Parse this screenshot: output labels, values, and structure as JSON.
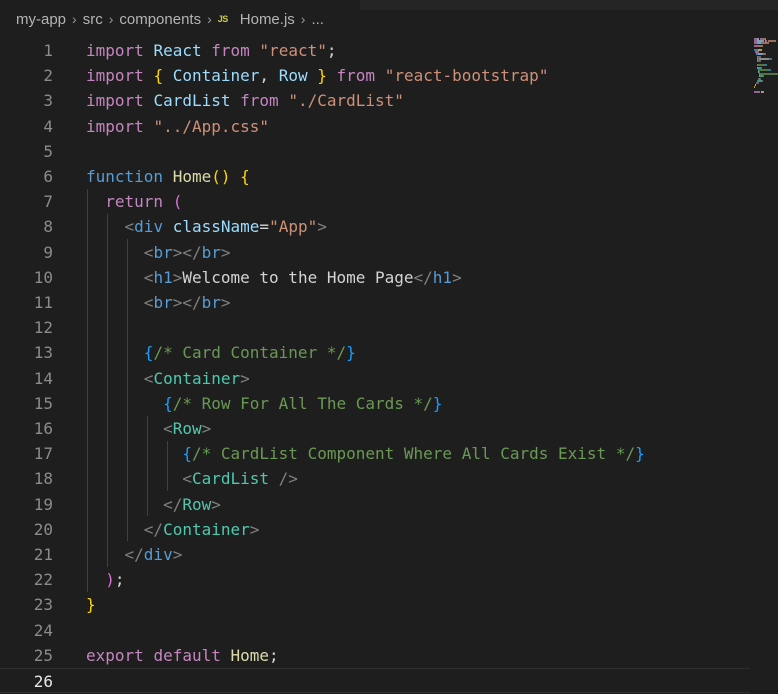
{
  "breadcrumb": {
    "items": [
      "my-app",
      "src",
      "components"
    ],
    "file_icon": "JS",
    "file_name": "Home.js",
    "trailing": "..."
  },
  "editor": {
    "current_line": 26,
    "lines": [
      {
        "n": "1",
        "tokens": [
          [
            "kw",
            "import"
          ],
          [
            "txt",
            " "
          ],
          [
            "var",
            "React"
          ],
          [
            "txt",
            " "
          ],
          [
            "kw",
            "from"
          ],
          [
            "txt",
            " "
          ],
          [
            "str",
            "\"react\""
          ],
          [
            "txt",
            ";"
          ]
        ]
      },
      {
        "n": "2",
        "tokens": [
          [
            "kw",
            "import"
          ],
          [
            "txt",
            " "
          ],
          [
            "p1",
            "{"
          ],
          [
            "txt",
            " "
          ],
          [
            "var",
            "Container"
          ],
          [
            "txt",
            ", "
          ],
          [
            "var",
            "Row"
          ],
          [
            "txt",
            " "
          ],
          [
            "p1",
            "}"
          ],
          [
            "txt",
            " "
          ],
          [
            "kw",
            "from"
          ],
          [
            "txt",
            " "
          ],
          [
            "str",
            "\"react-bootstrap\""
          ]
        ]
      },
      {
        "n": "3",
        "tokens": [
          [
            "kw",
            "import"
          ],
          [
            "txt",
            " "
          ],
          [
            "var",
            "CardList"
          ],
          [
            "txt",
            " "
          ],
          [
            "kw",
            "from"
          ],
          [
            "txt",
            " "
          ],
          [
            "str",
            "\"./CardList\""
          ]
        ]
      },
      {
        "n": "4",
        "tokens": [
          [
            "kw",
            "import"
          ],
          [
            "txt",
            " "
          ],
          [
            "str",
            "\"../App.css\""
          ]
        ]
      },
      {
        "n": "5",
        "tokens": []
      },
      {
        "n": "6",
        "tokens": [
          [
            "kb",
            "function"
          ],
          [
            "txt",
            " "
          ],
          [
            "fn",
            "Home"
          ],
          [
            "p1",
            "()"
          ],
          [
            "txt",
            " "
          ],
          [
            "p1",
            "{"
          ]
        ]
      },
      {
        "n": "7",
        "tokens": [
          [
            "txt",
            "  "
          ],
          [
            "kw",
            "return"
          ],
          [
            "txt",
            " "
          ],
          [
            "p2",
            "("
          ]
        ]
      },
      {
        "n": "8",
        "tokens": [
          [
            "txt",
            "    "
          ],
          [
            "punct",
            "<"
          ],
          [
            "tag",
            "div"
          ],
          [
            "txt",
            " "
          ],
          [
            "attr",
            "className"
          ],
          [
            "txt",
            "="
          ],
          [
            "str",
            "\"App\""
          ],
          [
            "punct",
            ">"
          ]
        ]
      },
      {
        "n": "9",
        "tokens": [
          [
            "txt",
            "      "
          ],
          [
            "punct",
            "<"
          ],
          [
            "tag",
            "br"
          ],
          [
            "punct",
            "></"
          ],
          [
            "tag",
            "br"
          ],
          [
            "punct",
            ">"
          ]
        ]
      },
      {
        "n": "10",
        "tokens": [
          [
            "txt",
            "      "
          ],
          [
            "punct",
            "<"
          ],
          [
            "tag",
            "h1"
          ],
          [
            "punct",
            ">"
          ],
          [
            "txt",
            "Welcome to the Home Page"
          ],
          [
            "punct",
            "</"
          ],
          [
            "tag",
            "h1"
          ],
          [
            "punct",
            ">"
          ]
        ]
      },
      {
        "n": "11",
        "tokens": [
          [
            "txt",
            "      "
          ],
          [
            "punct",
            "<"
          ],
          [
            "tag",
            "br"
          ],
          [
            "punct",
            "></"
          ],
          [
            "tag",
            "br"
          ],
          [
            "punct",
            ">"
          ]
        ]
      },
      {
        "n": "12",
        "tokens": []
      },
      {
        "n": "13",
        "tokens": [
          [
            "txt",
            "      "
          ],
          [
            "p3",
            "{"
          ],
          [
            "cm",
            "/* Card Container */"
          ],
          [
            "p3",
            "}"
          ]
        ]
      },
      {
        "n": "14",
        "tokens": [
          [
            "txt",
            "      "
          ],
          [
            "punct",
            "<"
          ],
          [
            "cmp",
            "Container"
          ],
          [
            "punct",
            ">"
          ]
        ]
      },
      {
        "n": "15",
        "tokens": [
          [
            "txt",
            "        "
          ],
          [
            "p3",
            "{"
          ],
          [
            "cm",
            "/* Row For All The Cards */"
          ],
          [
            "p3",
            "}"
          ]
        ]
      },
      {
        "n": "16",
        "tokens": [
          [
            "txt",
            "        "
          ],
          [
            "punct",
            "<"
          ],
          [
            "cmp",
            "Row"
          ],
          [
            "punct",
            ">"
          ]
        ]
      },
      {
        "n": "17",
        "tokens": [
          [
            "txt",
            "          "
          ],
          [
            "p3",
            "{"
          ],
          [
            "cm",
            "/* CardList Component Where All Cards Exist */"
          ],
          [
            "p3",
            "}"
          ]
        ]
      },
      {
        "n": "18",
        "tokens": [
          [
            "txt",
            "          "
          ],
          [
            "punct",
            "<"
          ],
          [
            "cmp",
            "CardList"
          ],
          [
            "txt",
            " "
          ],
          [
            "punct",
            "/>"
          ]
        ]
      },
      {
        "n": "19",
        "tokens": [
          [
            "txt",
            "        "
          ],
          [
            "punct",
            "</"
          ],
          [
            "cmp",
            "Row"
          ],
          [
            "punct",
            ">"
          ]
        ]
      },
      {
        "n": "20",
        "tokens": [
          [
            "txt",
            "      "
          ],
          [
            "punct",
            "</"
          ],
          [
            "cmp",
            "Container"
          ],
          [
            "punct",
            ">"
          ]
        ]
      },
      {
        "n": "21",
        "tokens": [
          [
            "txt",
            "    "
          ],
          [
            "punct",
            "</"
          ],
          [
            "tag",
            "div"
          ],
          [
            "punct",
            ">"
          ]
        ]
      },
      {
        "n": "22",
        "tokens": [
          [
            "txt",
            "  "
          ],
          [
            "p2",
            ")"
          ],
          [
            "txt",
            ";"
          ]
        ]
      },
      {
        "n": "23",
        "tokens": [
          [
            "p1",
            "}"
          ]
        ]
      },
      {
        "n": "24",
        "tokens": []
      },
      {
        "n": "25",
        "tokens": [
          [
            "kw",
            "export"
          ],
          [
            "txt",
            " "
          ],
          [
            "kw",
            "default"
          ],
          [
            "txt",
            " "
          ],
          [
            "fn",
            "Home"
          ],
          [
            "txt",
            ";"
          ]
        ]
      },
      {
        "n": "26",
        "tokens": []
      }
    ]
  },
  "colors": {
    "background": "#1e1e1e",
    "keyword": "#c586c0",
    "string": "#ce9178",
    "comment": "#6a9955",
    "component": "#4ec9b0",
    "variable": "#9cdcfe",
    "function": "#dcdcaa"
  }
}
